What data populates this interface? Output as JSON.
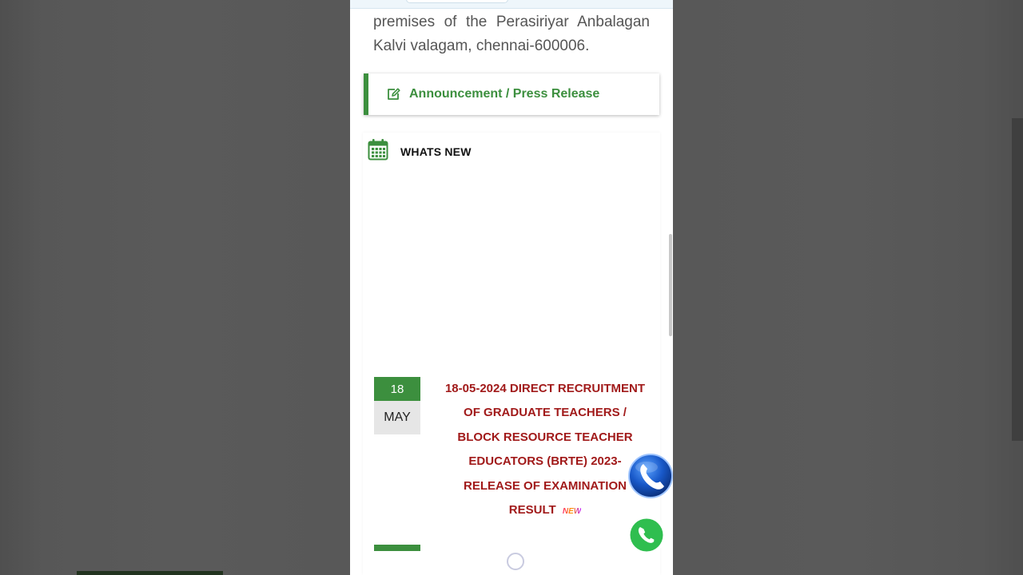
{
  "paragraph": {
    "text": "premises of the Perasiriyar Anbalagan Kalvi valagam, chennai-600006."
  },
  "announcement": {
    "label": "Announcement / Press Release",
    "icon": "edit-icon"
  },
  "whats_new": {
    "title": "WHATS NEW",
    "icon": "calendar-icon",
    "items": [
      {
        "day": "18",
        "month": "MAY",
        "title": "18-05-2024 DIRECT RECRUITMENT OF GRADUATE TEACHERS / BLOCK RESOURCE TEACHER EDUCATORS (BRTE) 2023- RELEASE OF EXAMINATION RESULT",
        "badge": "NEW"
      }
    ]
  },
  "floating": {
    "call_icon": "phone-icon",
    "whatsapp_icon": "whatsapp-icon"
  },
  "colors": {
    "accent_green": "#3c8f3e",
    "news_red": "#a11a1a",
    "paragraph_gray": "#555555"
  }
}
